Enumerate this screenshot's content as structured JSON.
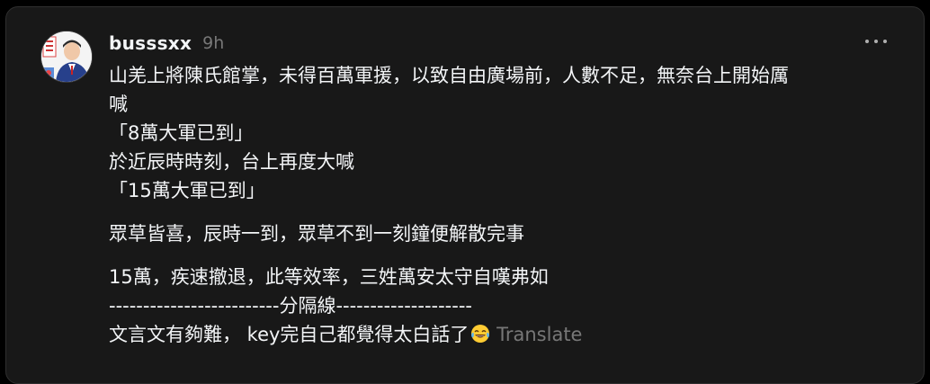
{
  "post": {
    "username": "busssxx",
    "timestamp": "9h",
    "lines": [
      "山羌上將陳氏館掌，未得百萬軍援，以致自由廣場前，人數不足，無奈台上開始厲",
      "喊",
      "「8萬大軍已到」",
      "於近辰時時刻，台上再度大喊",
      "「15萬大軍已到」",
      "眾草皆喜，辰時一到，眾草不到一刻鐘便解散完事",
      "15萬，疾速撤退，此等效率，三姓萬安太守自嘆弗如",
      "-------------------------分隔線--------------------",
      "文言文有夠難， key完自己都覺得太白話了"
    ],
    "emoji": "tears-of-joy-emoji",
    "translate_label": "Translate"
  },
  "icons": {
    "more": "more-options-icon",
    "avatar": "profile-avatar"
  },
  "colors": {
    "background": "#000000",
    "card": "#181818",
    "text": "#f3f5f7",
    "muted": "#777777",
    "border": "#2f2f2f"
  }
}
